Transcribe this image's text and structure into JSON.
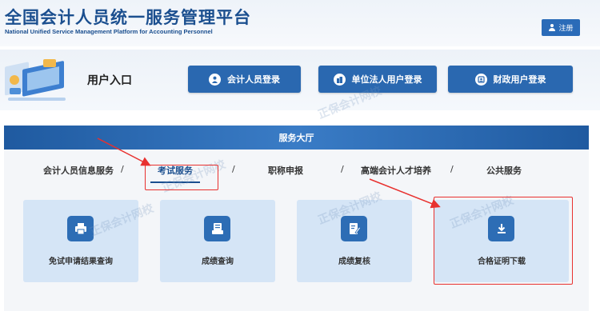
{
  "header": {
    "title": "全国会计人员统一服务管理平台",
    "subtitle": "National Unified Service Management Platform for Accounting Personnel",
    "register_label": "注册"
  },
  "entry": {
    "label": "用户入口",
    "buttons": [
      {
        "label": "会计人员登录",
        "icon": "user-icon"
      },
      {
        "label": "单位法人用户登录",
        "icon": "building-icon"
      },
      {
        "label": "财政用户登录",
        "icon": "badge-icon"
      }
    ]
  },
  "hall": {
    "title": "服务大厅",
    "nav": [
      {
        "label": "会计人员信息服务"
      },
      {
        "label": "考试服务"
      },
      {
        "label": "职称申报"
      },
      {
        "label": "高端会计人才培养"
      },
      {
        "label": "公共服务"
      }
    ],
    "separator": "/",
    "active_tab": "考试服务",
    "cards": [
      {
        "label": "免试申请结果查询",
        "icon": "printer-icon"
      },
      {
        "label": "成绩查询",
        "icon": "document-list-icon"
      },
      {
        "label": "成绩复核",
        "icon": "edit-document-icon"
      },
      {
        "label": "合格证明下载",
        "icon": "download-icon"
      }
    ]
  },
  "watermark": {
    "text": "正保会计网校"
  },
  "colors": {
    "brand": "#1b4f8f",
    "button": "#2a68b0",
    "card": "#d5e5f6",
    "highlight": "#e8312f"
  }
}
